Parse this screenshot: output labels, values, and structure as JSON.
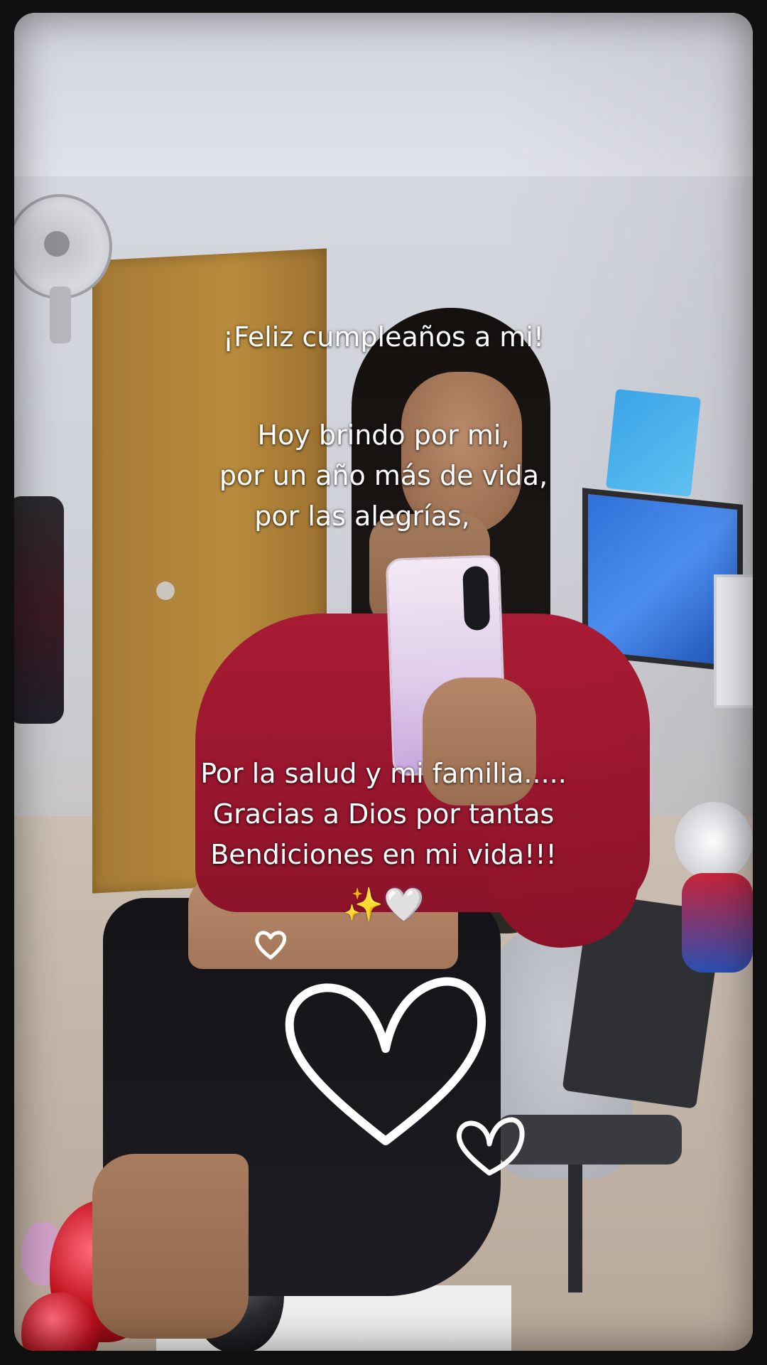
{
  "caption": {
    "title": "¡Feliz cumpleaños a mi!",
    "lines_middle": [
      "Hoy brindo por mi,",
      "por un año más de vida,",
      "por las alegrías,"
    ],
    "lines_bottom": [
      "Por la salud y mi familia.....",
      "Gracias a Dios por tantas",
      "Bendiciones en mi vida!!!"
    ],
    "emoji_line": {
      "sparkles": "✨",
      "white_heart": "🤍"
    }
  },
  "colors": {
    "text": "#ffffff",
    "shirt": "#a81b34",
    "door": "#b88b3d",
    "tv_screen": "#3a7fe0"
  },
  "decorations": {
    "heart_icons": [
      "small-heart-doodle-icon",
      "large-heart-doodle-icon",
      "medium-heart-doodle-icon"
    ]
  }
}
